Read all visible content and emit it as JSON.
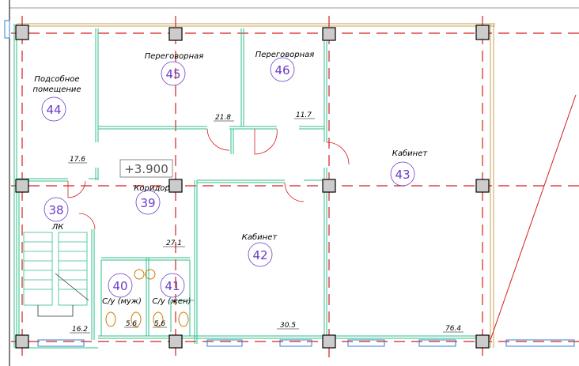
{
  "elevation": "+3.900",
  "rooms": [
    {
      "number": "44",
      "name_line1": "Подсобное",
      "name_line2": "помещение",
      "area": "17.6"
    },
    {
      "number": "45",
      "name": "Переговорная",
      "area": "21.8"
    },
    {
      "number": "46",
      "name": "Переговорная",
      "area": "11.7"
    },
    {
      "number": "43",
      "name": "Кабинет",
      "area": "76.4"
    },
    {
      "number": "39",
      "name": "Коридор",
      "area": "27.1"
    },
    {
      "number": "38",
      "name": "ЛК",
      "area": "16.2"
    },
    {
      "number": "42",
      "name": "Кабинет",
      "area": "30.5"
    },
    {
      "number": "40",
      "name": "С/у (муж)",
      "area": "5.6"
    },
    {
      "number": "41",
      "name": "С/у (жен)",
      "area": "5.6"
    }
  ],
  "colors": {
    "wall": "#2fbf8a",
    "axis": "#d81d1d",
    "column": "#000000",
    "number": "#6a3bc8",
    "outer_wall": "#c8a050"
  }
}
